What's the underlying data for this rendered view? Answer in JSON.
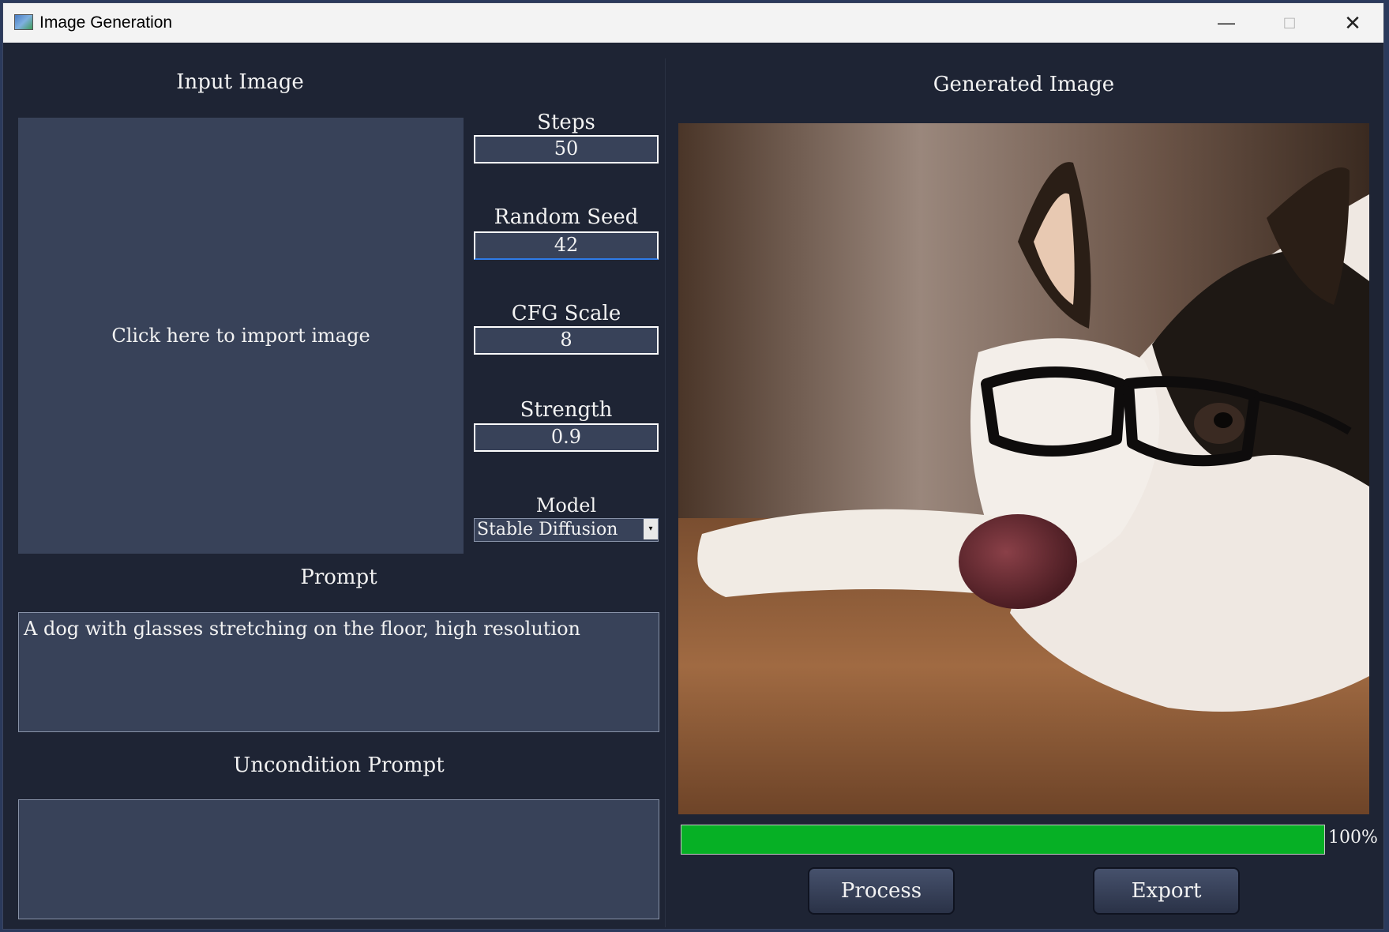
{
  "window": {
    "title": "Image Generation",
    "minimize_glyph": "—",
    "maximize_glyph": "□",
    "close_glyph": "✕"
  },
  "input_image": {
    "label": "Input Image",
    "placeholder": "Click here to import image"
  },
  "params": {
    "steps_label": "Steps",
    "steps_value": "50",
    "seed_label": "Random Seed",
    "seed_value": "42",
    "cfg_label": "CFG Scale",
    "cfg_value": "8",
    "strength_label": "Strength",
    "strength_value": "0.9",
    "model_label": "Model",
    "model_value": "Stable Diffusion",
    "model_arrow": "▾"
  },
  "prompt": {
    "label": "Prompt",
    "value": "A dog with glasses stretching on the floor, high resolution"
  },
  "uncond_prompt": {
    "label": "Uncondition Prompt",
    "value": ""
  },
  "output": {
    "label": "Generated Image",
    "image_subject": "dog-wearing-glasses-lying-on-carpet",
    "progress_percent": 100,
    "progress_text": "100%"
  },
  "buttons": {
    "process_label": "Process",
    "export_label": "Export"
  },
  "colors": {
    "background": "#1e2434",
    "panel": "#384259",
    "progress_fill": "#06b025"
  }
}
